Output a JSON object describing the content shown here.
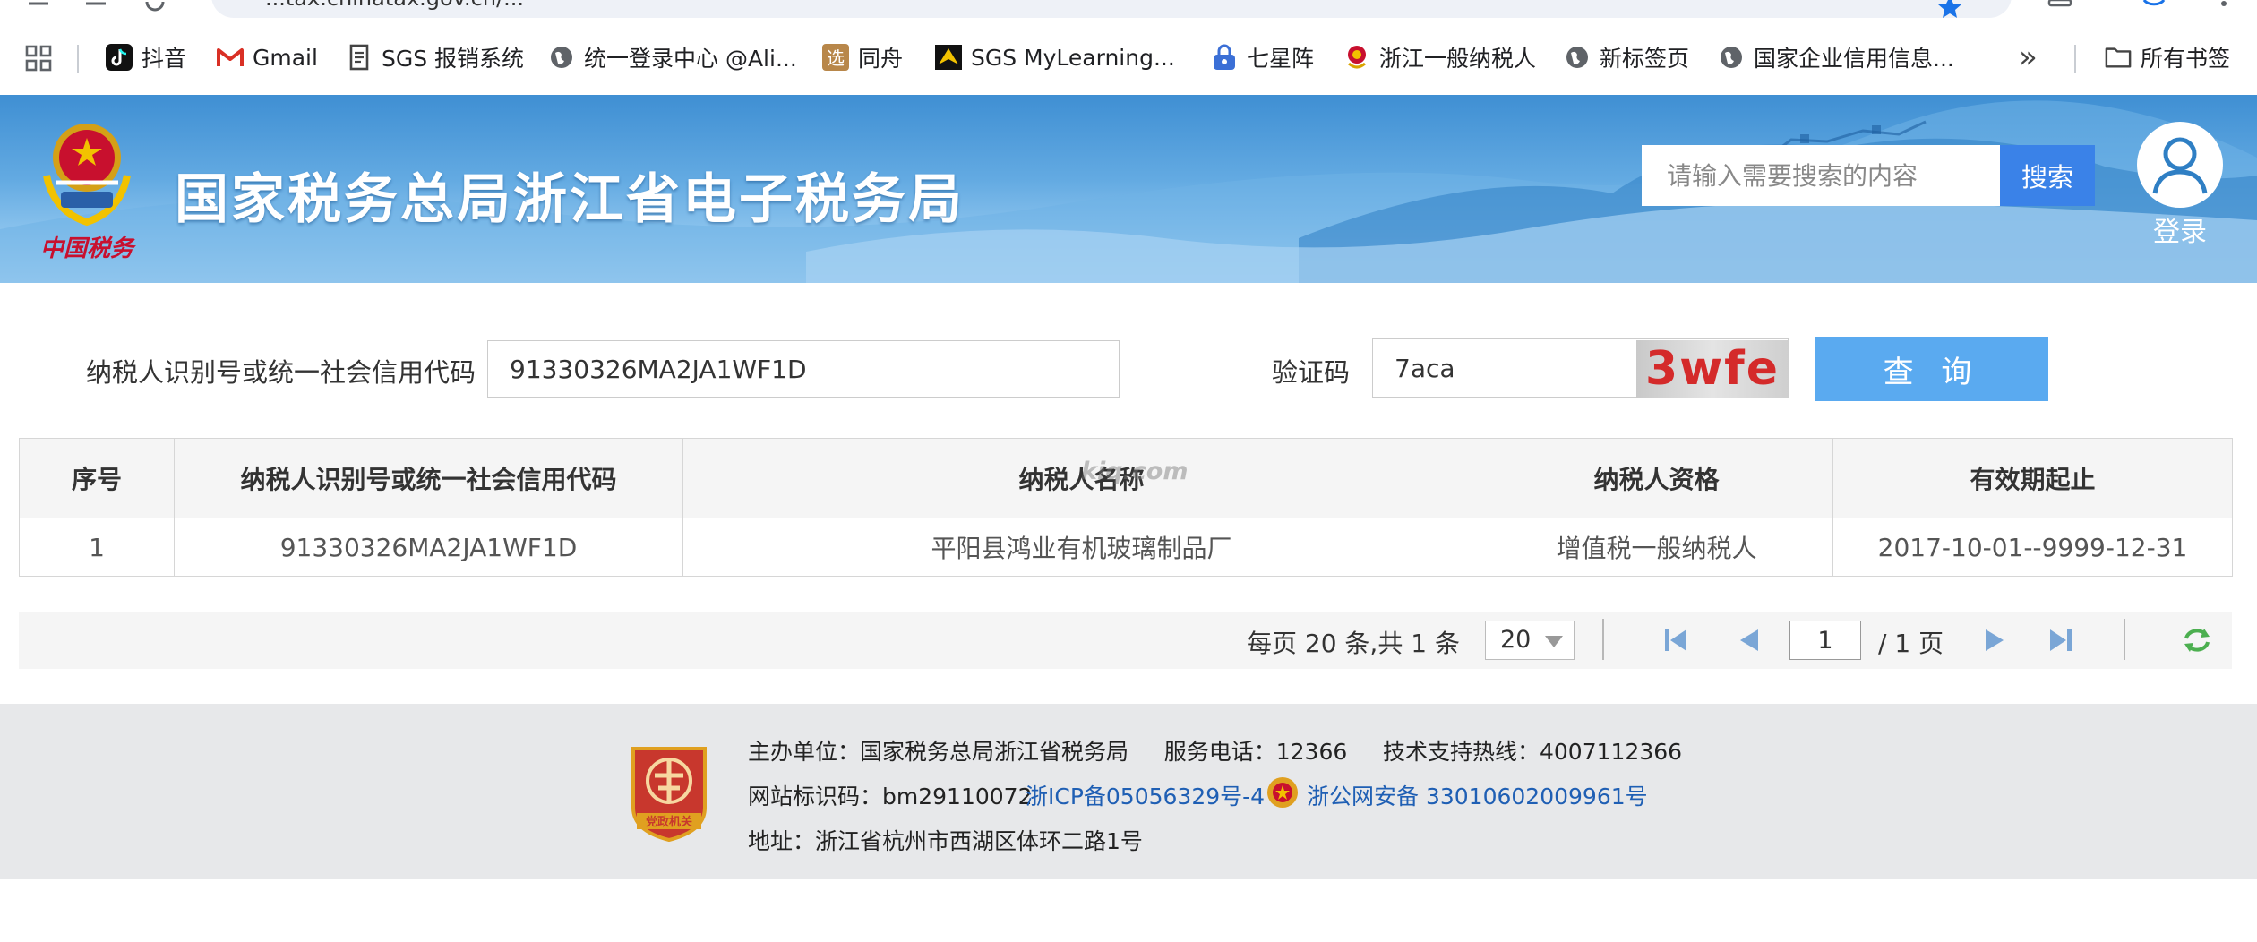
{
  "browser": {
    "url_fragment": "...tax.chinatax.gov.cn/...",
    "bookmarks": [
      {
        "label": "抖音",
        "icon": "douyin-icon"
      },
      {
        "label": "Gmail",
        "icon": "gmail-icon"
      },
      {
        "label": "SGS 报销系统",
        "icon": "document-icon"
      },
      {
        "label": "统一登录中心 @Ali...",
        "icon": "globe-icon"
      },
      {
        "label": "同舟",
        "icon": "tongzhou-icon"
      },
      {
        "label": "SGS MyLearning...",
        "icon": "mylearning-icon"
      },
      {
        "label": "七星阵",
        "icon": "lock-icon"
      },
      {
        "label": "浙江一般纳税人",
        "icon": "tax-bureau-icon"
      },
      {
        "label": "新标签页",
        "icon": "globe-icon"
      },
      {
        "label": "国家企业信用信息...",
        "icon": "globe-icon"
      }
    ],
    "more_label": "»",
    "all_bookmarks_label": "所有书签"
  },
  "banner": {
    "emblem_text": "中国税务",
    "title": "国家税务总局浙江省电子税务局",
    "search_placeholder": "请输入需要搜索的内容",
    "search_button": "搜索",
    "login_label": "登录"
  },
  "form": {
    "taxpayer_id_label": "纳税人识别号或统一社会信用代码",
    "taxpayer_id_value": "91330326MA2JA1WF1D",
    "captcha_label": "验证码",
    "captcha_value": "7aca",
    "captcha_image_text": "3wfe",
    "query_button": "查 询"
  },
  "table": {
    "watermark": "kiq.com",
    "headers": [
      "序号",
      "纳税人识别号或统一社会信用代码",
      "纳税人名称",
      "纳税人资格",
      "有效期起止"
    ],
    "rows": [
      [
        "1",
        "91330326MA2JA1WF1D",
        "平阳县鸿业有机玻璃制品厂",
        "增值税一般纳税人",
        "2017-10-01--9999-12-31"
      ]
    ]
  },
  "pager": {
    "summary": "每页 20 条,共 1 条",
    "page_size": "20",
    "current_page": "1",
    "total_pages": "/ 1 页"
  },
  "footer": {
    "badge_text": "党政机关",
    "line1": "主办单位：国家税务总局浙江省税务局     服务电话：12366     技术支持热线：4007112366",
    "site_id": "网站标识码：bm29110072",
    "icp": "浙ICP备05056329号-4",
    "police": "浙公网安备 33010602009961号",
    "address": "地址：浙江省杭州市西湖区体环二路1号"
  },
  "colors": {
    "accent_blue": "#3a82e8",
    "query_button": "#5aaaf0",
    "banner_blue": "#4b9bdb",
    "link_blue": "#1f5fb4",
    "captcha_red": "#d42a2a"
  }
}
